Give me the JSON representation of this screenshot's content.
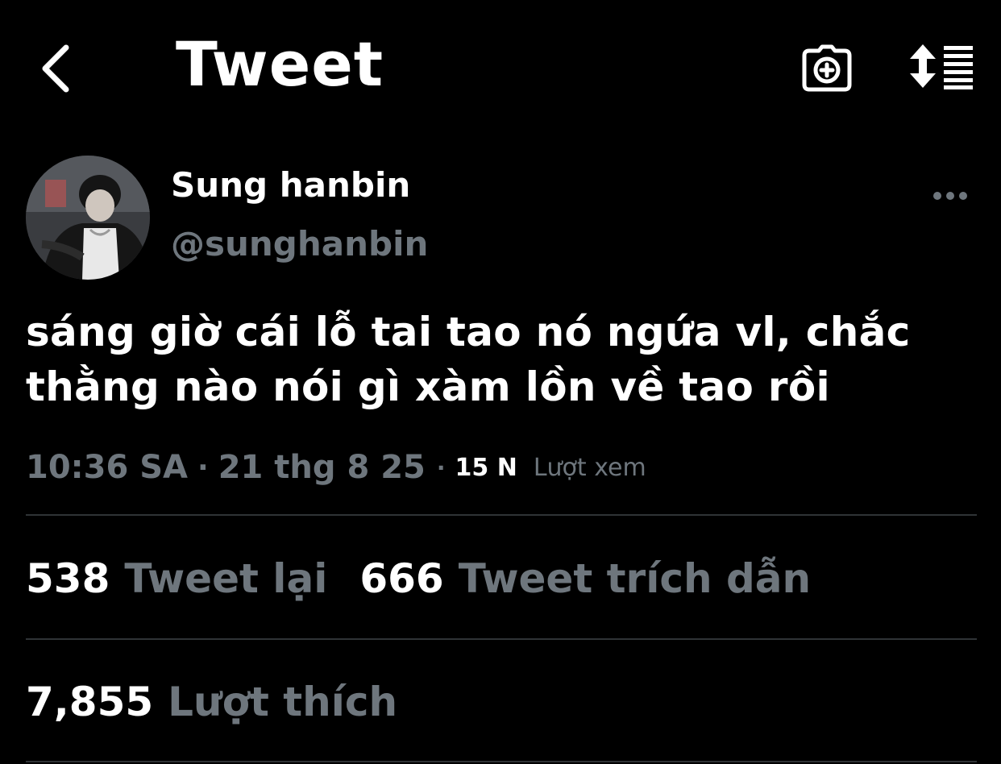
{
  "header": {
    "title": "Tweet",
    "back_icon": "chevron-left-icon",
    "camera_icon": "camera-plus-icon",
    "sort_icon": "sort-list-icon"
  },
  "author": {
    "display_name": "Sung hanbin",
    "handle": "@sunghanbin"
  },
  "tweet": {
    "text_line1": "sáng giờ cái lỗ tai tao nó ngứa vl, chắc",
    "text_line2": "thằng nào nói gì xàm lồn về tao rồi"
  },
  "meta": {
    "time": "10:36 SA",
    "separator": "·",
    "date": "21 thg 8 25",
    "views_count": "15 N",
    "views_label": "Lượt xem"
  },
  "stats": {
    "retweets_count": "538",
    "retweets_label": "Tweet lại",
    "quotes_count": "666",
    "quotes_label": "Tweet trích dẫn",
    "likes_count": "7,855",
    "likes_label": "Lượt thích"
  },
  "colors": {
    "background": "#000000",
    "text_primary": "#ffffff",
    "text_secondary": "#6e767d",
    "divider": "#2f3336"
  }
}
